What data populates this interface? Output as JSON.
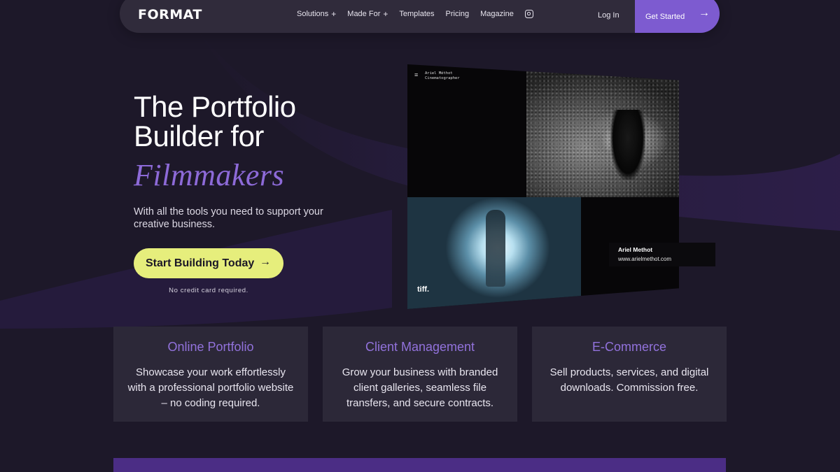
{
  "brand": {
    "logo": "FORMAT"
  },
  "nav": {
    "links": [
      {
        "label": "Solutions",
        "has_plus": true
      },
      {
        "label": "Made For",
        "has_plus": true
      },
      {
        "label": "Templates",
        "has_plus": false
      },
      {
        "label": "Pricing",
        "has_plus": false
      },
      {
        "label": "Magazine",
        "has_plus": false
      }
    ],
    "instagram_icon": "instagram-icon",
    "login": "Log In",
    "get_started": "Get Started"
  },
  "hero": {
    "title": "The Portfolio Builder for",
    "title_accent": "Filmmakers",
    "subtitle": "With all the tools you need to support your creative business.",
    "cta": "Start Building Today",
    "cta_note": "No credit card required."
  },
  "mockup": {
    "menu_icon": "≡",
    "site_name": "Ariel Méthot",
    "site_role": "Cinematographer",
    "tiff_logo": "tiff.",
    "caption_name": "Ariel Methot",
    "caption_url": "www.arielmethot.com"
  },
  "cards": [
    {
      "title": "Online Portfolio",
      "body": "Showcase your work effortlessly with a professional portfolio website – no coding  required."
    },
    {
      "title": "Client Management",
      "body": "Grow your business with branded client galleries, seamless file transfers, and secure contracts."
    },
    {
      "title": "E-Commerce",
      "body": "Sell products, services, and digital downloads. Commission free."
    }
  ],
  "colors": {
    "background": "#1d1829",
    "nav": "#302b3b",
    "accent_purple": "#7d5bd0",
    "accent_text": "#8d6ad8",
    "cta_yellow": "#e6ee7c",
    "card": "#2c2838"
  }
}
